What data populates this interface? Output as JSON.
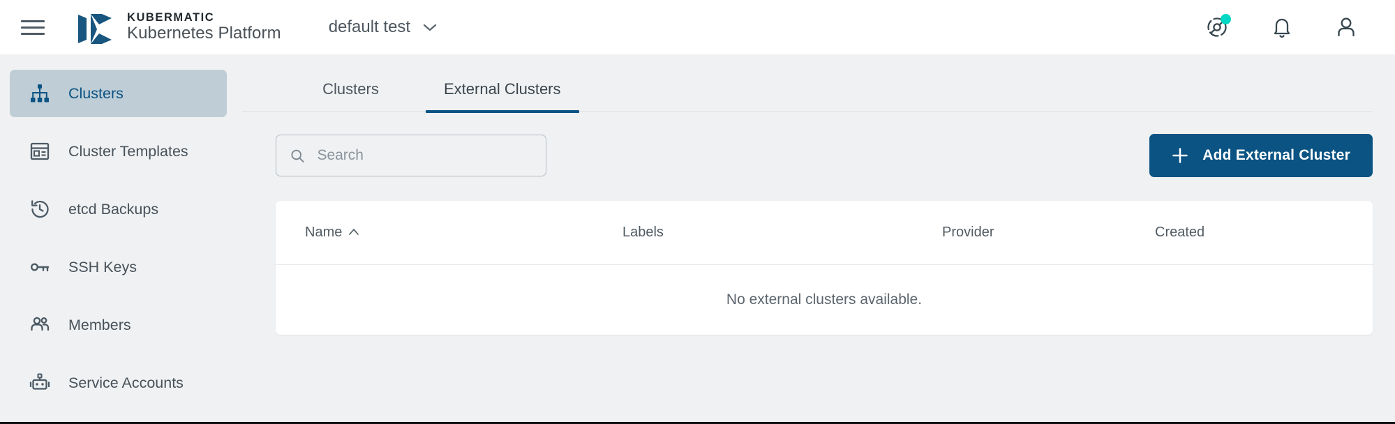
{
  "topbar": {
    "menu_icon": "hamburger-menu-icon",
    "logo_icon": "kubermatic-logo-icon",
    "brand_top": "KUBERMATIC",
    "brand_bottom": "Kubernetes Platform",
    "project": {
      "name": "default test",
      "chevron_icon": "chevron-down-icon"
    },
    "icons": [
      {
        "name": "help-tour-icon",
        "has_badge": true,
        "badge_color": "#00d7c4"
      },
      {
        "name": "notifications-bell-icon",
        "has_badge": false
      },
      {
        "name": "user-account-icon",
        "has_badge": false
      }
    ]
  },
  "sidebar": {
    "items": [
      {
        "label": "Clusters",
        "icon": "cluster-hierarchy-icon",
        "active": true
      },
      {
        "label": "Cluster Templates",
        "icon": "template-document-icon",
        "active": false
      },
      {
        "label": "etcd Backups",
        "icon": "backup-restore-clock-icon",
        "active": false
      },
      {
        "label": "SSH Keys",
        "icon": "ssh-key-icon",
        "active": false
      },
      {
        "label": "Members",
        "icon": "members-people-icon",
        "active": false
      },
      {
        "label": "Service Accounts",
        "icon": "service-account-robot-icon",
        "active": false
      }
    ]
  },
  "main": {
    "tabs": [
      {
        "label": "Clusters",
        "active": false
      },
      {
        "label": "External Clusters",
        "active": true
      }
    ],
    "search": {
      "placeholder": "Search",
      "value": "",
      "icon": "search-icon"
    },
    "add_button": {
      "label": "Add External Cluster",
      "icon": "plus-icon"
    },
    "table": {
      "columns": [
        {
          "label": "Name",
          "sortable": true,
          "sort_direction": "asc"
        },
        {
          "label": "Labels",
          "sortable": false,
          "sort_direction": ""
        },
        {
          "label": "Provider",
          "sortable": false,
          "sort_direction": ""
        },
        {
          "label": "Created",
          "sortable": false,
          "sort_direction": ""
        }
      ],
      "rows": [],
      "empty_message": "No external clusters available."
    }
  },
  "colors": {
    "accent": "#0a5383",
    "badge": "#00d7c4",
    "page_bg": "#eff1f3",
    "active_nav_bg": "#bfcdd6",
    "card_bg": "#ffffff"
  }
}
